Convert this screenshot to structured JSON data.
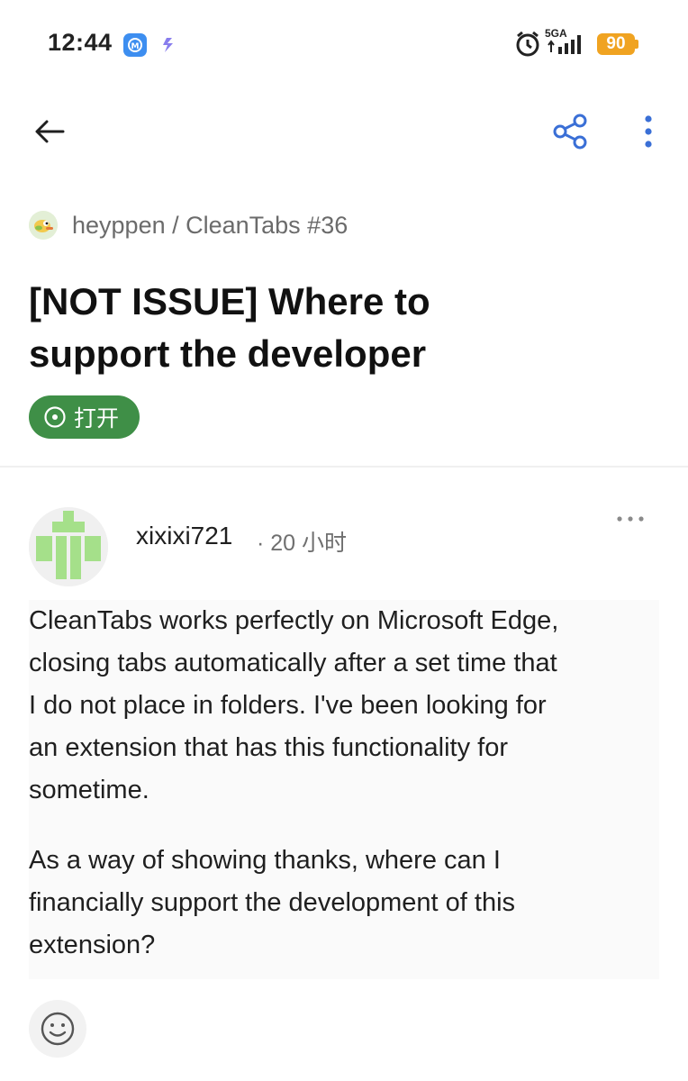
{
  "status_bar": {
    "time": "12:44",
    "network": "5GA",
    "battery": "90",
    "colors": {
      "battery": "#f0a321",
      "app_icon": "#3d8ef0"
    }
  },
  "topbar": {
    "icons": [
      "back-arrow-icon",
      "share-icon",
      "more-vertical-icon"
    ],
    "accent": "#3a6fd6"
  },
  "issue": {
    "repo_path": "heyppen / CleanTabs #36",
    "title_line1": "[NOT ISSUE] Where to",
    "title_line2": "support the developer",
    "state_label": "打开",
    "state_color": "#3f8f47"
  },
  "comment": {
    "author": "xixixi721",
    "time_ago": "· 20 小时",
    "body_p1_lines": [
      "CleanTabs works perfectly on Microsoft Edge,",
      "closing tabs automatically after a set time that",
      "I do not place in folders. I've been looking for",
      "an extension that has this functionality for",
      "sometime."
    ],
    "body_p2_lines": [
      "As a way of showing thanks, where can I",
      "financially support the development of this",
      "extension?"
    ],
    "reaction_icon": "smiley-icon"
  }
}
